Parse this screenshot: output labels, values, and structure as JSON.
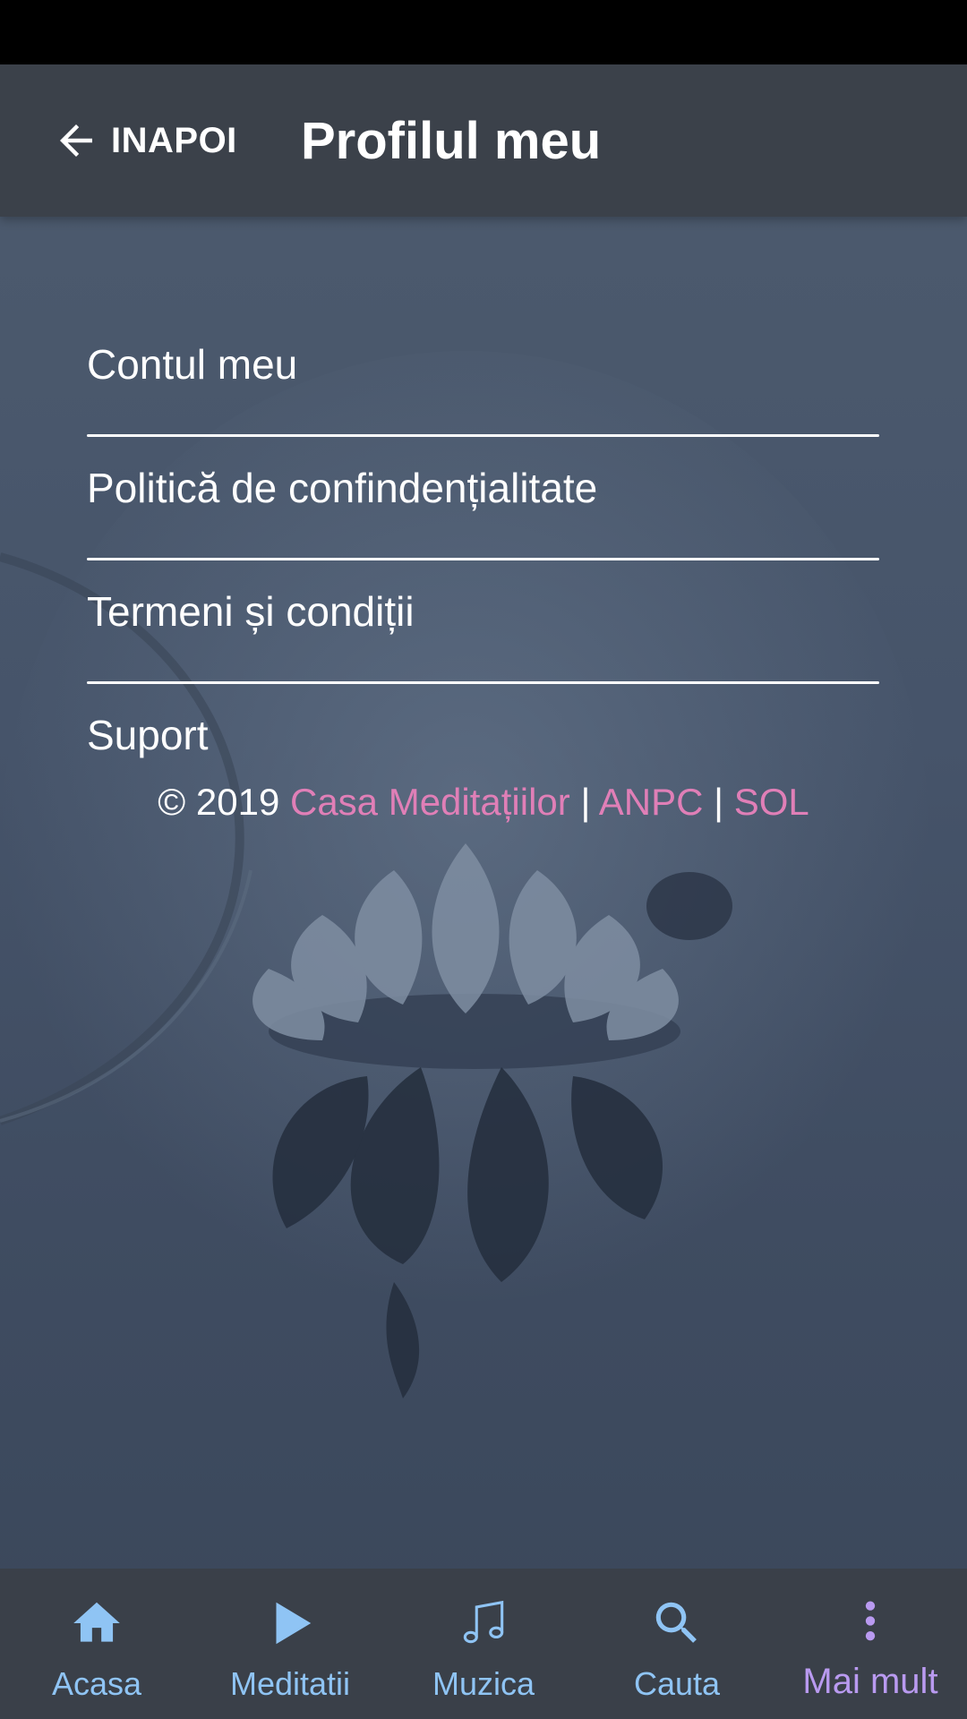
{
  "header": {
    "back_label": "INAPOI",
    "title": "Profilul meu"
  },
  "menu": {
    "items": [
      {
        "label": "Contul meu"
      },
      {
        "label": "Politică de confindențialitate"
      },
      {
        "label": "Termeni și condiții"
      },
      {
        "label": "Suport"
      }
    ]
  },
  "footer": {
    "prefix": "© 2019",
    "link1": "Casa Meditațiilor",
    "sep1": "|",
    "link2": "ANPC",
    "sep2": "|",
    "link3": "SOL"
  },
  "bottom_nav": {
    "items": [
      {
        "label": "Acasa",
        "icon": "home-icon"
      },
      {
        "label": "Meditatii",
        "icon": "play-icon"
      },
      {
        "label": "Muzica",
        "icon": "music-note-icon"
      },
      {
        "label": "Cauta",
        "icon": "search-icon"
      },
      {
        "label": "Mai mult",
        "icon": "more-vertical-icon"
      }
    ],
    "active_index": 4
  },
  "colors": {
    "header_bg": "#3b414a",
    "link": "#e07fb7",
    "nav_label": "#8fc4f4",
    "nav_active": "#b99af0"
  }
}
